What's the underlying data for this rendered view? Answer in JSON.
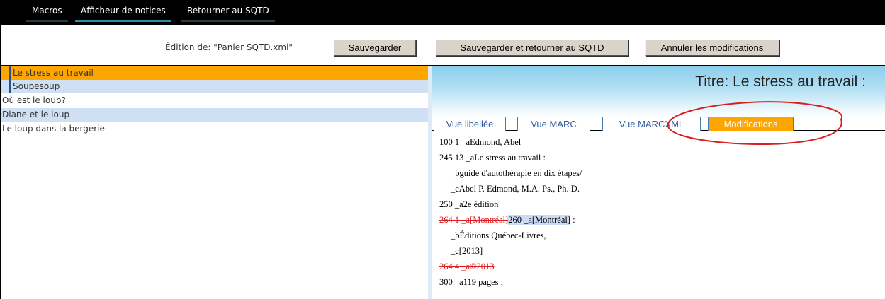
{
  "menu": {
    "items": [
      {
        "label": "Macros"
      },
      {
        "label": "Afficheur de notices"
      },
      {
        "label": "Retourner au SQTD"
      }
    ]
  },
  "toolbar": {
    "edition_label": "Édition de: \"Panier SQTD.xml\"",
    "save_label": "Sauvegarder",
    "save_return_label": "Sauvegarder et retourner au SQTD",
    "cancel_label": "Annuler les modifications"
  },
  "records": [
    {
      "label": "Le stress au travail"
    },
    {
      "label": "Soupesoup"
    },
    {
      "label": "Où est le loup?"
    },
    {
      "label": "Diane et le loup"
    },
    {
      "label": "Le loup dans la bergerie"
    }
  ],
  "panel": {
    "title": "Titre: Le stress au travail :",
    "tabs": [
      {
        "label": "Vue libellée"
      },
      {
        "label": "Vue MARC"
      },
      {
        "label": "Vue MARCXML"
      },
      {
        "label": "Modifications"
      }
    ],
    "lines": {
      "l1": "100 1  _aEdmond, Abel",
      "l2": "245 13 _aLe stress au travail :",
      "l3": "_bguide d'autothérapie en dix étapes/",
      "l4": "_cAbel P. Edmond, M.A. Ps., Ph. D.",
      "l5": "250    _a2e édition",
      "l6_del": "264  1  _a[Montréal]",
      "l6_ins_a": "260    _a[Montréal]",
      "l6_ins_b": " :",
      "l7": "_bÉditions Québec-Livres,",
      "l8": "_c[2013]",
      "l9_del": "264  4  _a©2013",
      "l10": "300    _a119 pages ;"
    }
  },
  "colors": {
    "menubar": "#000000",
    "selected_row": "#ffa500",
    "alt_row": "#cfe0f5",
    "active_tab": "#ffa500",
    "deleted_text": "#e02020",
    "annotation": "#d81e1e"
  }
}
